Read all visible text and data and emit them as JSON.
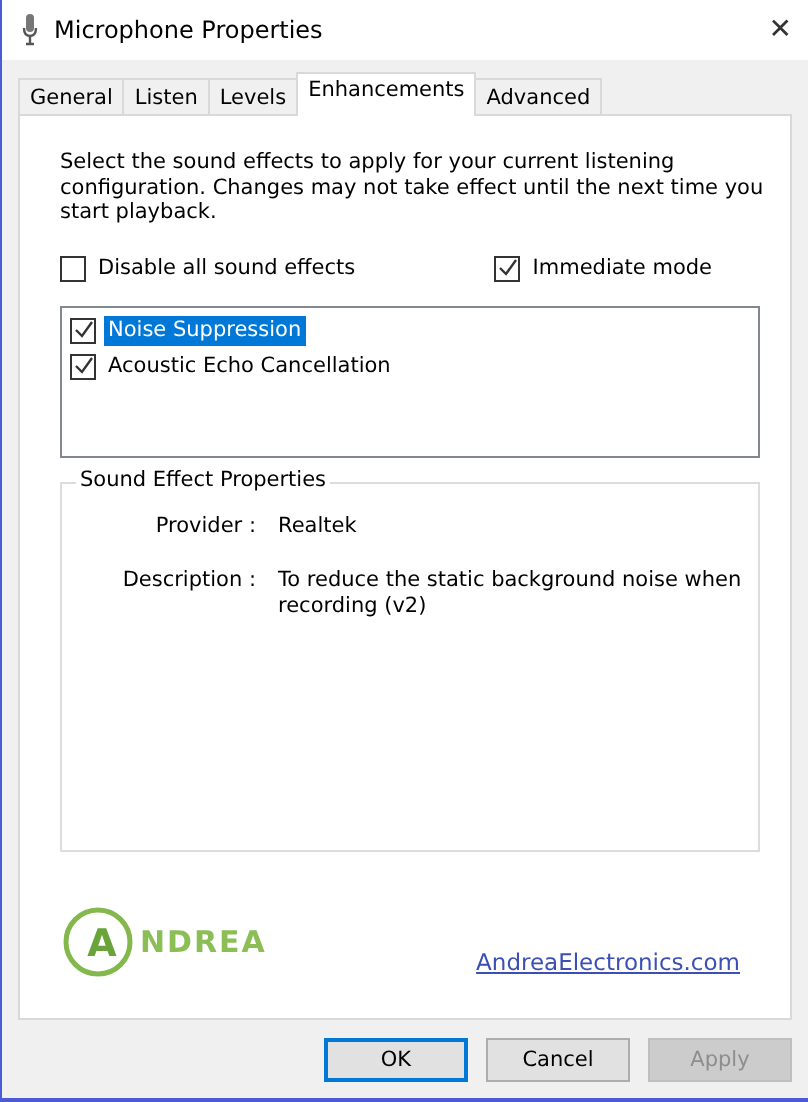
{
  "window": {
    "title": "Microphone Properties",
    "close": "✕"
  },
  "tabs": [
    {
      "label": "General",
      "selected": false
    },
    {
      "label": "Listen",
      "selected": false
    },
    {
      "label": "Levels",
      "selected": false
    },
    {
      "label": "Enhancements",
      "selected": true
    },
    {
      "label": "Advanced",
      "selected": false
    }
  ],
  "intro": "Select the sound effects to apply for your current listening configuration. Changes may not take effect until the next time you start playback.",
  "options": [
    {
      "label": "Disable all sound effects",
      "checked": false
    },
    {
      "label": "Immediate mode",
      "checked": true
    }
  ],
  "effects": [
    {
      "label": "Noise Suppression",
      "checked": true,
      "selected": true
    },
    {
      "label": "Acoustic Echo Cancellation",
      "checked": true,
      "selected": false
    }
  ],
  "properties": {
    "title": "Sound Effect Properties",
    "rows": [
      {
        "label": "Provider :",
        "value": "Realtek"
      },
      {
        "label": "Description :",
        "value": "To reduce the static background noise when recording (v2)"
      }
    ]
  },
  "logo": {
    "mark": "A",
    "word": "NDREA"
  },
  "link": "AndreaElectronics.com",
  "buttons": [
    {
      "label": "OK",
      "kind": "default",
      "disabled": false
    },
    {
      "label": "Cancel",
      "kind": "normal",
      "disabled": false
    },
    {
      "label": "Apply",
      "kind": "normal",
      "disabled": true
    }
  ]
}
